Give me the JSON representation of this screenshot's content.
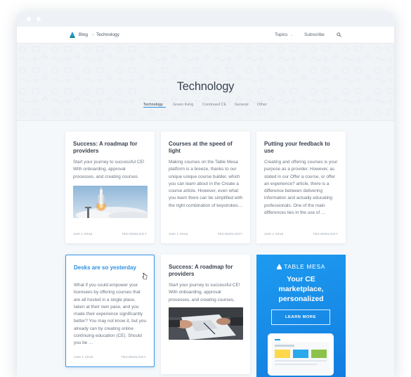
{
  "window": {
    "title": ""
  },
  "topbar": {
    "crumbs": {
      "blog": "Blog",
      "separator": "›",
      "current": "Technology"
    },
    "nav": {
      "topics": "Topics",
      "topics_chevron": "⌄",
      "subscribe": "Subscribe"
    }
  },
  "hero": {
    "title": "Technology"
  },
  "tabs": [
    {
      "label": "Technology",
      "active": true
    },
    {
      "label": "Green living"
    },
    {
      "label": "Continued CE"
    },
    {
      "label": "General"
    },
    {
      "label": "Other"
    }
  ],
  "cards": [
    {
      "title": "Success: A roadmap for providers",
      "excerpt": "Start your journey to successful CE! With onboarding, approval processes, and creating courses",
      "date": "JUN 1 2016",
      "tag": "TECHNOLOGY",
      "image": "rocket-launch"
    },
    {
      "title": "Courses at the speed of light",
      "excerpt": "Making courses on the Table Mesa platform is a breeze, thanks to our unique unique course builder, which you can learn about in the Create a course article. However, even what you learn there can be simplified with the right combination of keystrokes…",
      "date": "JUN 1 2016",
      "tag": "TECHNOLOGY"
    },
    {
      "title": "Putting your feedback to use",
      "excerpt": "Creating and offering courses is your purpose as a provider. However, as stated in our Offer a course, or offer an experience? article, there is a difference between delivering information and actually educating professionals. One of the main differences lies in the use of …",
      "date": "JUN 1 2016",
      "tag": "TECHNOLOGY"
    },
    {
      "title": "Desks are so yesterday",
      "excerpt": "What if you could empower your licensees by offering courses that are all hosted in a single place, taken at their own pace, and you made their experience significantly better? You may not know it, but you already can by creating online continuing education (CE). Should you be …",
      "date": "JUN 1 2016",
      "tag": "TECHNOLOGY"
    },
    {
      "title": "Success: A roadmap for providers",
      "excerpt": "Start your journey to successful CE! With onboarding, approval processes, and creating courses,",
      "image": "hands-meeting"
    }
  ],
  "ad": {
    "brand": "TABLE MESA",
    "headline_line1": "Your CE",
    "headline_line2": "marketplace,",
    "headline_line3": "personalized",
    "cta": "LEARN MORE"
  },
  "colors": {
    "accent": "#2d8ee0",
    "ad_background": "#1a8eea",
    "text_dark": "#3a4350",
    "text_muted": "#6b7480"
  }
}
